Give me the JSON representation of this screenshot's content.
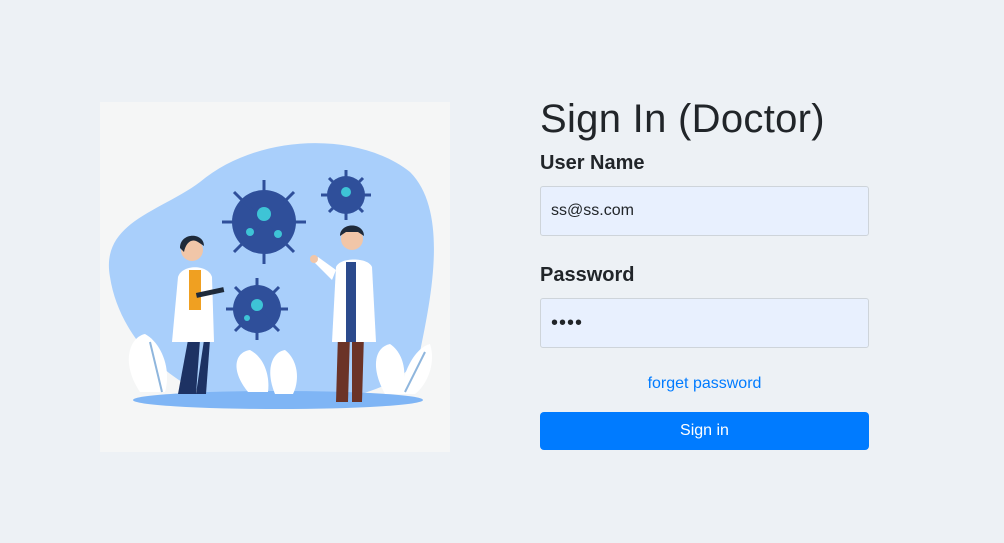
{
  "illustration": {
    "icon": "doctors-virus-illustration"
  },
  "form": {
    "title": "Sign In (Doctor)",
    "username_label": "User Name",
    "username_value": "ss@ss.com",
    "password_label": "Password",
    "password_value": "ssss",
    "forget_link": "forget password",
    "signin_button": "Sign in"
  },
  "colors": {
    "background": "#edf1f5",
    "accent": "#007bff",
    "input_bg": "#e8f0fe"
  }
}
